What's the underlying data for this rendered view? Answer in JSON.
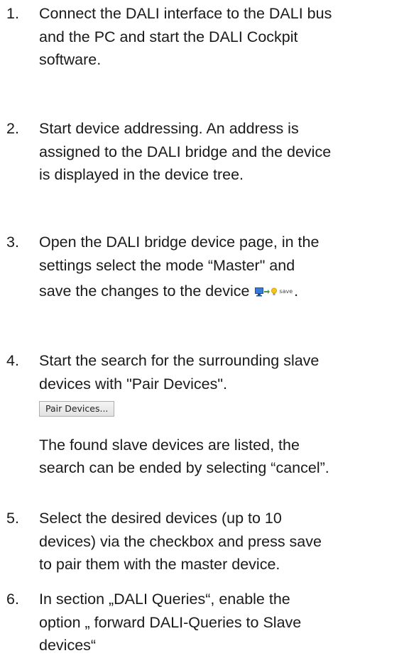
{
  "steps": [
    {
      "number": "1.",
      "lines": [
        "Connect the DALI interface to the DALI bus",
        "and the PC and start the DALI Cockpit",
        "software."
      ]
    },
    {
      "number": "2.",
      "lines": [
        "Start device addressing. An address is",
        "assigned to the DALI bridge and the device",
        "is displayed in the device tree."
      ]
    },
    {
      "number": "3.",
      "lines": [
        "Open the DALI bridge device page, in the",
        "settings select the mode “Master\" and",
        "save the changes to the device"
      ],
      "icon_name": "save-to-bus-icon",
      "icon_label": "save",
      "end": "."
    },
    {
      "number": "4.",
      "lines": [
        "Start the search for the surrounding slave",
        "devices with \"Pair Devices\"."
      ],
      "button_label": "Pair Devices...",
      "after_lines": [
        "The found slave devices are listed, the",
        "search can be ended by selecting “cancel”."
      ]
    },
    {
      "number": "5.",
      "lines": [
        "Select the desired devices (up to 10",
        "devices) via the checkbox and press save",
        "to pair them with the master device."
      ]
    },
    {
      "number": "6.",
      "lines": [
        "In section „DALI Queries“, enable the",
        "option „ forward DALI-Queries to Slave",
        "devices“"
      ]
    }
  ]
}
